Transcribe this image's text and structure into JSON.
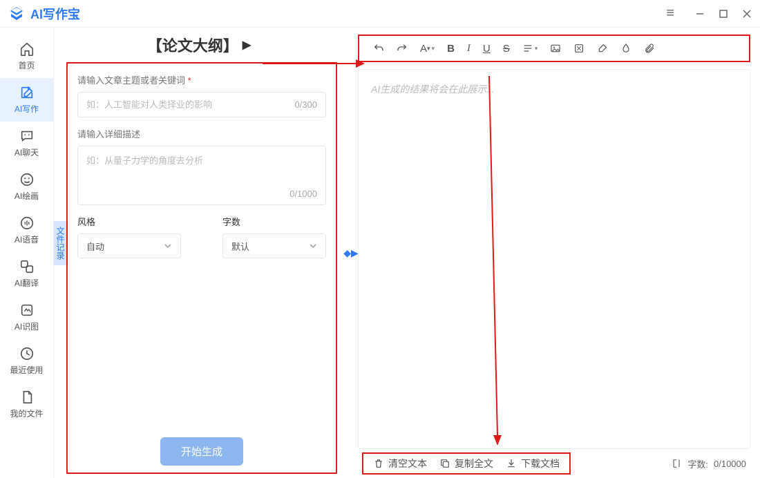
{
  "app_name": "AI写作宝",
  "sidebar": {
    "items": [
      {
        "label": "首页"
      },
      {
        "label": "AI写作"
      },
      {
        "label": "AI聊天"
      },
      {
        "label": "AI绘画"
      },
      {
        "label": "AI语音"
      },
      {
        "label": "AI翻译"
      },
      {
        "label": "AI识图"
      },
      {
        "label": "最近使用"
      },
      {
        "label": "我的文件"
      }
    ]
  },
  "file_record_tab": "文件记录",
  "page_title": "【论文大纲】",
  "form": {
    "topic_label": "请输入文章主题或者关键词",
    "topic_placeholder": "如：人工智能对人类择业的影响",
    "topic_counter": "0/300",
    "detail_label": "请输入详细描述",
    "detail_placeholder": "如：从量子力学的角度去分析",
    "detail_counter": "0/1000",
    "style_label": "风格",
    "style_value": "自动",
    "count_label": "字数",
    "count_value": "默认",
    "generate_label": "开始生成"
  },
  "editor": {
    "placeholder": "AI生成的结果将会在此展示..."
  },
  "footer": {
    "clear": "清空文本",
    "copy": "复制全文",
    "download": "下载文档",
    "wordcount_label": "字数:",
    "wordcount_value": "0/10000"
  }
}
